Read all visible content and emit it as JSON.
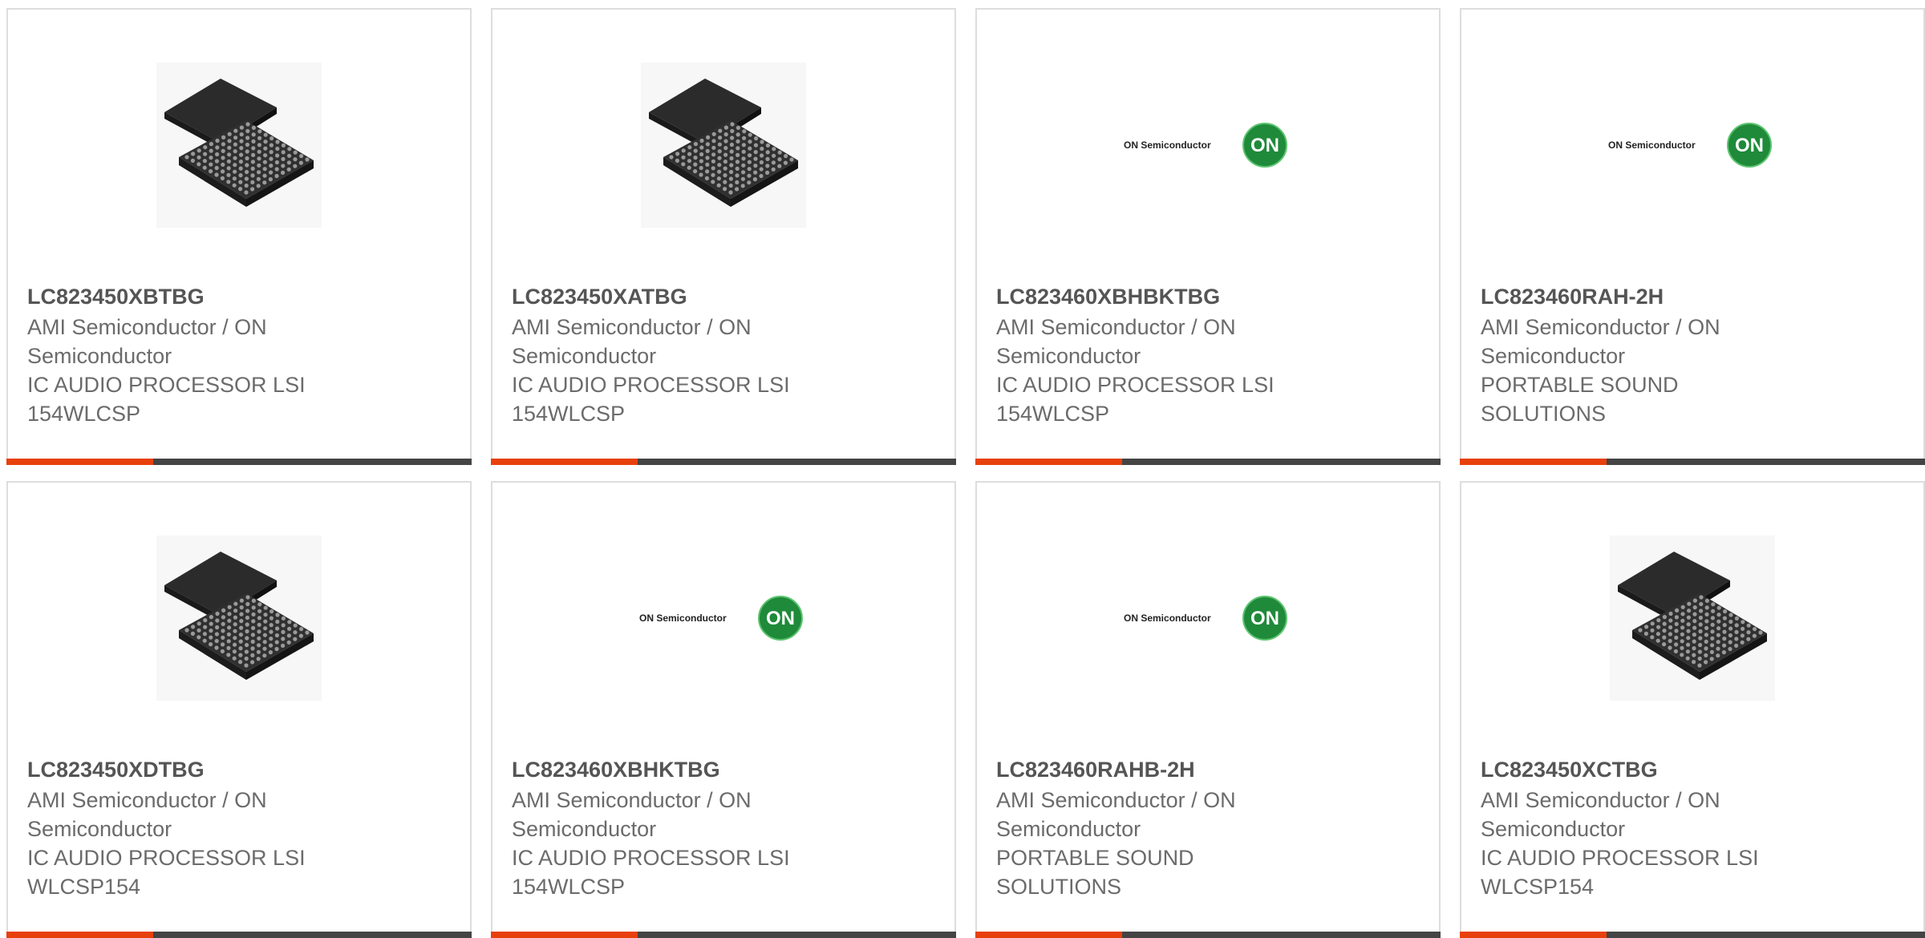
{
  "colors": {
    "accent": "#e8400c",
    "bar_dark": "#444444",
    "text": "#6b6b6b",
    "border": "#dddddd"
  },
  "products": [
    {
      "part": "LC823450XBTBG",
      "manufacturer": "AMI Semiconductor / ON Semiconductor",
      "description": "IC AUDIO PROCESSOR LSI 154WLCSP",
      "image": "bga-chip-image"
    },
    {
      "part": "LC823450XATBG",
      "manufacturer": "AMI Semiconductor / ON Semiconductor",
      "description": "IC AUDIO PROCESSOR LSI 154WLCSP",
      "image": "bga-chip-image"
    },
    {
      "part": "LC823460XBHBKTBG",
      "manufacturer": "AMI Semiconductor / ON Semiconductor",
      "description": "IC AUDIO PROCESSOR LSI 154WLCSP",
      "image": "on-semiconductor-logo"
    },
    {
      "part": "LC823460RAH-2H",
      "manufacturer": "AMI Semiconductor / ON Semiconductor",
      "description": "PORTABLE SOUND SOLUTIONS",
      "image": "on-semiconductor-logo"
    },
    {
      "part": "LC823450XDTBG",
      "manufacturer": "AMI Semiconductor / ON Semiconductor",
      "description": "IC AUDIO PROCESSOR LSI WLCSP154",
      "image": "bga-chip-image"
    },
    {
      "part": "LC823460XBHKTBG",
      "manufacturer": "AMI Semiconductor / ON Semiconductor",
      "description": "IC AUDIO PROCESSOR LSI 154WLCSP",
      "image": "on-semiconductor-logo"
    },
    {
      "part": "LC823460RAHB-2H",
      "manufacturer": "AMI Semiconductor / ON Semiconductor",
      "description": "PORTABLE SOUND SOLUTIONS",
      "image": "on-semiconductor-logo"
    },
    {
      "part": "LC823450XCTBG",
      "manufacturer": "AMI Semiconductor / ON Semiconductor",
      "description": "IC AUDIO PROCESSOR LSI WLCSP154",
      "image": "bga-chip-image"
    }
  ],
  "logo": {
    "wordmark": "ON Semiconductor",
    "badge": "ON"
  }
}
